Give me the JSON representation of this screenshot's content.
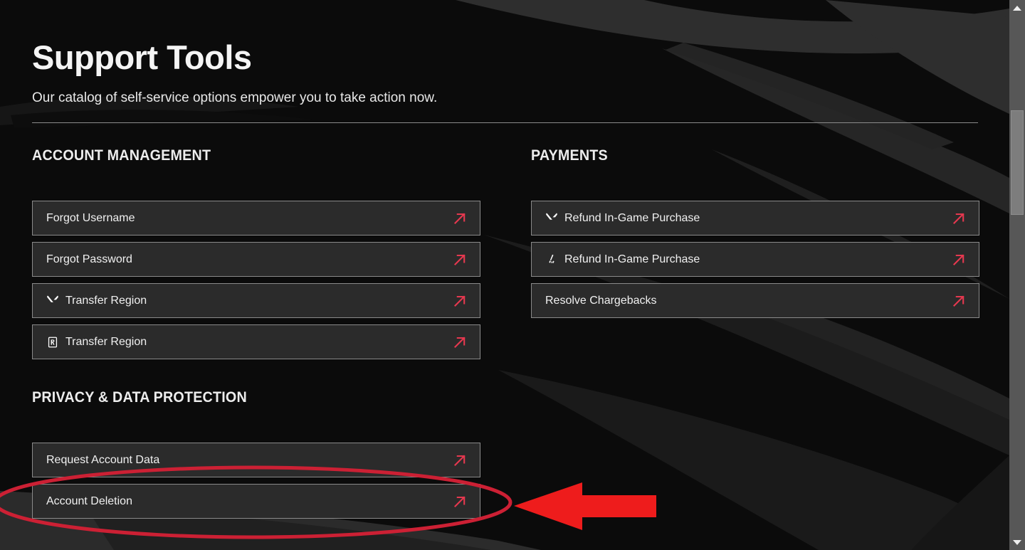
{
  "page": {
    "title": "Support Tools",
    "subtitle": "Our catalog of self-service options empower you to take action now."
  },
  "colors": {
    "accent_red": "#e5384f",
    "annotation_red": "#ee1c1c",
    "ellipse_red": "#cc2034",
    "page_bg": "#0b0b0b",
    "button_bg": "#2b2b2b",
    "button_border": "#8a8a8a",
    "text_primary": "#f0f0f0",
    "divider": "#8b8b8b"
  },
  "sections": [
    {
      "id": "account-management",
      "column": "left",
      "title": "ACCOUNT MANAGEMENT",
      "items": [
        {
          "label": "Forgot Username",
          "game_icon": "none",
          "arrow_icon": "arrow-up-right-icon"
        },
        {
          "label": "Forgot Password",
          "game_icon": "none",
          "arrow_icon": "arrow-up-right-icon"
        },
        {
          "label": "Transfer Region",
          "game_icon": "valorant-icon",
          "arrow_icon": "arrow-up-right-icon"
        },
        {
          "label": "Transfer Region",
          "game_icon": "riot-r-icon",
          "arrow_icon": "arrow-up-right-icon"
        }
      ]
    },
    {
      "id": "privacy-data-protection",
      "column": "left",
      "title": "PRIVACY & DATA PROTECTION",
      "items": [
        {
          "label": "Request Account Data",
          "game_icon": "none",
          "arrow_icon": "arrow-up-right-icon"
        },
        {
          "label": "Account Deletion",
          "game_icon": "none",
          "arrow_icon": "arrow-up-right-icon"
        }
      ]
    },
    {
      "id": "payments",
      "column": "right",
      "title": "PAYMENTS",
      "items": [
        {
          "label": "Refund In-Game Purchase",
          "game_icon": "valorant-icon",
          "arrow_icon": "arrow-up-right-icon"
        },
        {
          "label": "Refund In-Game Purchase",
          "game_icon": "tft-icon",
          "arrow_icon": "arrow-up-right-icon"
        },
        {
          "label": "Resolve Chargebacks",
          "game_icon": "none",
          "arrow_icon": "arrow-up-right-icon"
        }
      ]
    }
  ],
  "annotations": {
    "highlight_ellipse": {
      "shape": "ellipse",
      "target": "Account Deletion",
      "color": "#cc2034"
    },
    "pointer_arrow": {
      "shape": "arrow",
      "direction": "left",
      "target": "Account Deletion",
      "color": "#ee1c1c"
    }
  },
  "scrollbar": {
    "up_arrow_icon": "triangle-up-icon",
    "down_arrow_icon": "triangle-down-icon",
    "orientation": "vertical"
  }
}
